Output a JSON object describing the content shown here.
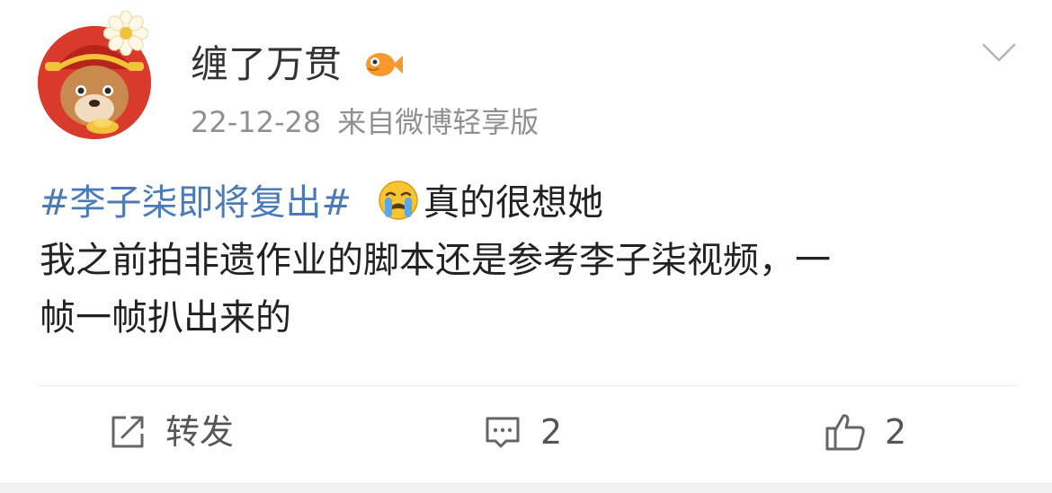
{
  "post": {
    "username": "缠了万贯",
    "date": "22-12-28",
    "source": "来自微博轻享版",
    "hashtag": "#李子柒即将复出#",
    "line1_text": "真的很想她",
    "line2": "我之前拍非遗作业的脚本还是参考李子柒视频，一",
    "line3": "帧一帧扒出来的"
  },
  "actions": {
    "repost_label": "转发",
    "comment_count": "2",
    "like_count": "2"
  },
  "icons": {
    "avatar": "bear-god-of-wealth-avatar",
    "badge": "fish-icon",
    "menu": "chevron-down-icon",
    "emoji": "crying-emoji",
    "repost": "repost-icon",
    "comment": "comment-icon",
    "like": "like-icon"
  },
  "colors": {
    "hashtag": "#4a7ab7",
    "username": "#333333",
    "meta": "#909090",
    "avatar_bg": "#d93a2b"
  }
}
